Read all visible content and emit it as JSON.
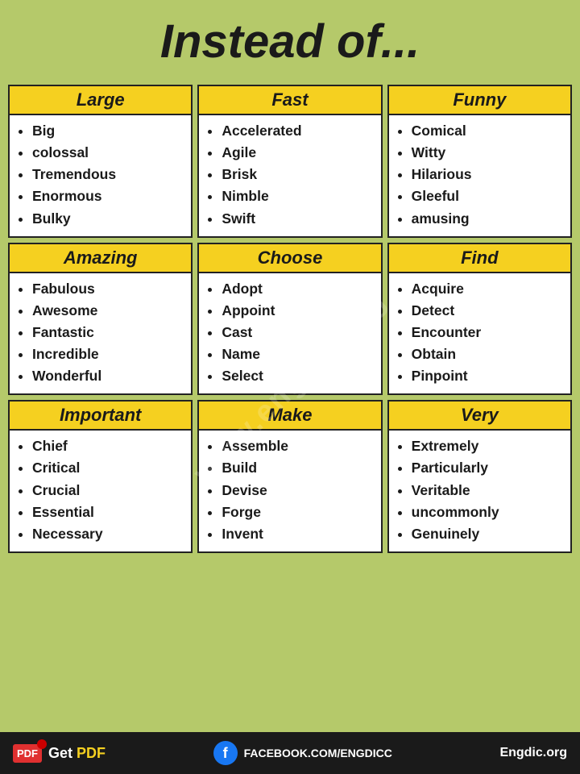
{
  "title": "Instead of...",
  "watermark": "www.engdic.org",
  "cards": [
    {
      "header": "Large",
      "items": [
        "Big",
        "colossal",
        "Tremendous",
        "Enormous",
        "Bulky"
      ]
    },
    {
      "header": "Fast",
      "items": [
        "Accelerated",
        "Agile",
        "Brisk",
        "Nimble",
        "Swift"
      ]
    },
    {
      "header": "Funny",
      "items": [
        "Comical",
        "Witty",
        "Hilarious",
        "Gleeful",
        "amusing"
      ]
    },
    {
      "header": "Amazing",
      "items": [
        "Fabulous",
        "Awesome",
        "Fantastic",
        "Incredible",
        "Wonderful"
      ]
    },
    {
      "header": "Choose",
      "items": [
        "Adopt",
        "Appoint",
        "Cast",
        "Name",
        "Select"
      ]
    },
    {
      "header": "Find",
      "items": [
        "Acquire",
        "Detect",
        "Encounter",
        "Obtain",
        "Pinpoint"
      ]
    },
    {
      "header": "Important",
      "items": [
        "Chief",
        "Critical",
        "Crucial",
        "Essential",
        "Necessary"
      ]
    },
    {
      "header": "Make",
      "items": [
        "Assemble",
        "Build",
        "Devise",
        "Forge",
        "Invent"
      ]
    },
    {
      "header": "Very",
      "items": [
        "Extremely",
        "Particularly",
        "Veritable",
        "uncommonly",
        "Genuinely"
      ]
    }
  ],
  "footer": {
    "get_pdf": "Get",
    "pdf_label": "PDF",
    "facebook_text": "FACEBOOK.COM/ENGDICC",
    "website": "Engdic.org"
  }
}
